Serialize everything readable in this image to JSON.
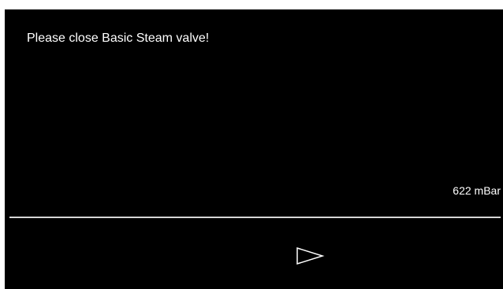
{
  "screen": {
    "message": "Please close Basic Steam valve!",
    "pressure_reading": "622 mBar"
  },
  "navigation": {
    "next_icon": "play-outline-icon"
  },
  "colors": {
    "background": "#000000",
    "text": "#ffffff",
    "divider": "#d6d6d6"
  }
}
